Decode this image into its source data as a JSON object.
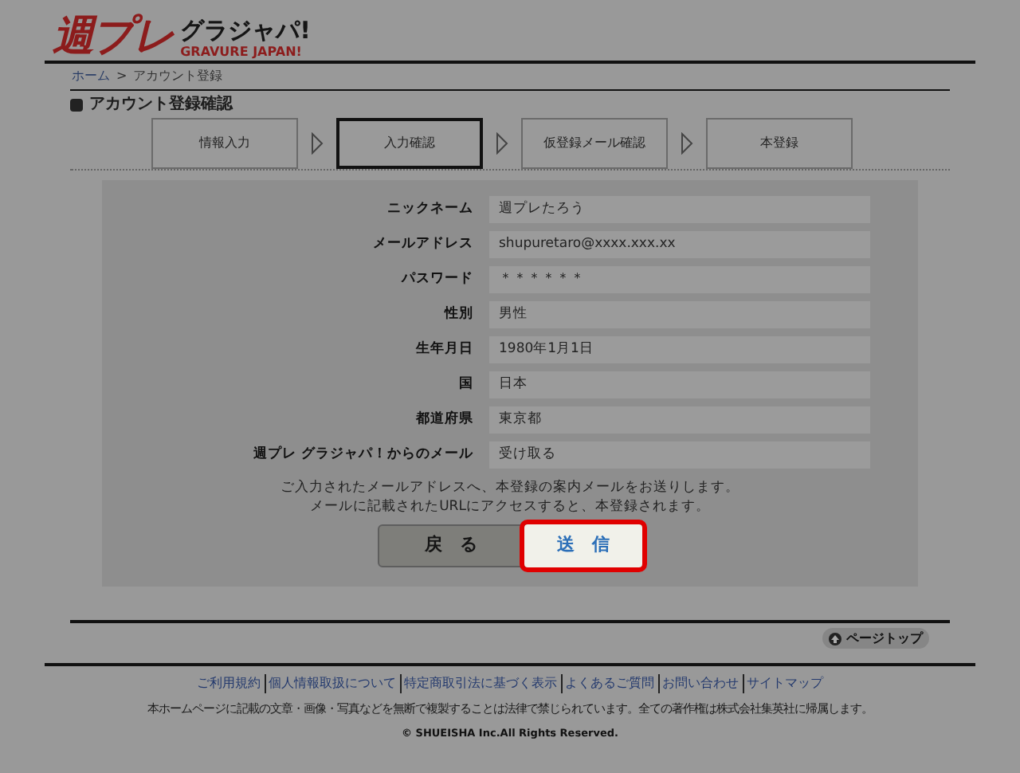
{
  "logo": {
    "main": "週プレ",
    "sub": "グラジャパ!",
    "roman": "GRAVURE JAPAN!"
  },
  "breadcrumb": [
    {
      "label": "ホーム"
    },
    {
      "label": "アカウント登録"
    }
  ],
  "breadcrumb_separator": ">",
  "heading": "アカウント登録確認",
  "steps": [
    {
      "label": "情報入力",
      "selected": false
    },
    {
      "label": "入力確認",
      "selected": true
    },
    {
      "label": "仮登録メール確認",
      "selected": false
    },
    {
      "label": "本登録",
      "selected": false
    }
  ],
  "fields": [
    {
      "label": "ニックネーム",
      "value": "週プレたろう"
    },
    {
      "label": "メールアドレス",
      "value": "shupuretaro@xxxx.xxx.xx"
    },
    {
      "label": "パスワード",
      "value": "＊＊＊＊＊＊"
    },
    {
      "label": "性別",
      "value": "男性"
    },
    {
      "label": "生年月日",
      "value": "1980年1月1日"
    },
    {
      "label": "国",
      "value": "日本"
    },
    {
      "label": "都道府県",
      "value": "東京都"
    },
    {
      "label": "週プレ グラジャパ！からのメール",
      "value": "受け取る"
    }
  ],
  "notice": [
    "ご入力されたメールアドレスへ、本登録の案内メールをお送りします。",
    "メールに記載されたURLにアクセスすると、本登録されます。"
  ],
  "buttons": [
    {
      "label": "戻　る",
      "kind": "back",
      "highlighted": false
    },
    {
      "label": "送　信",
      "kind": "submit",
      "highlighted": true
    }
  ],
  "page_top": "ページトップ",
  "footer_links": [
    "ご利用規約",
    "個人情報取扱について",
    "特定商取引法に基づく表示",
    "よくあるご質問",
    "お問い合わせ",
    "サイトマップ"
  ],
  "copyright_notice": "本ホームページに記載の文章・画像・写真などを無断で複製することは法律で禁じられています。全ての著作権は株式会社集英社に帰属します。",
  "copyright": "© SHUEISHA Inc.All Rights Reserved."
}
